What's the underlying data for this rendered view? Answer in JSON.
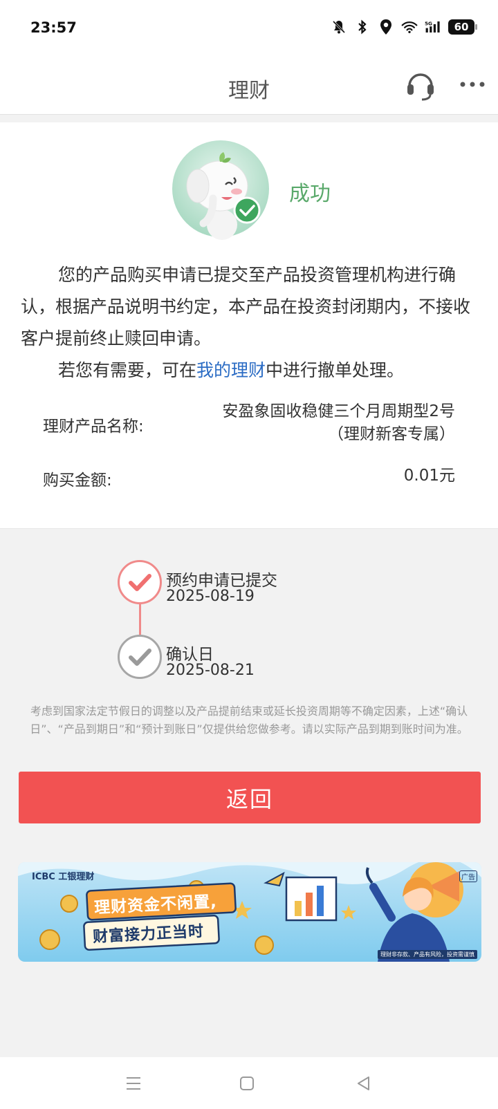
{
  "status_bar": {
    "time": "23:57",
    "icons": [
      "bell-off-icon",
      "bluetooth-icon",
      "location-icon",
      "wifi-icon",
      "signal-5g-icon"
    ],
    "battery": "60"
  },
  "nav": {
    "title": "理财",
    "support_icon": "headset-icon",
    "more_icon": "more-dots-icon"
  },
  "result": {
    "status": "成功",
    "message": "您的产品购买申请已提交至产品投资管理机构进行确认，根据产品说明书约定，本产品在投资封闭期内，不接收客户提前终止赎回申请。",
    "message2_prefix": "若您有需要，可在",
    "message2_link": "我的理财",
    "message2_suffix": "中进行撤单处理。"
  },
  "details": {
    "product_label": "理财产品名称:",
    "product_name_line1": "安盈象固收稳健三个月周期型2号",
    "product_name_line2": "（理财新客专属）",
    "amount_label": "购买金额:",
    "amount_value": "0.01元"
  },
  "timeline": [
    {
      "title": "预约申请已提交",
      "date": "2025-08-19",
      "state": "done"
    },
    {
      "title": "确认日",
      "date": "2025-08-21",
      "state": "pending"
    }
  ],
  "disclaimer_line1": "考虑到国家法定节假日的调整以及产品提前结束或延长投资周期等不确定因素，上述“确认",
  "disclaimer_line2": "日”、“产品到期日”和“预计到账日”仅提供给您做参考。请以实际产品到期到账时间为准。",
  "back_button": "返回",
  "banner": {
    "brand": "ICBC 工银理财",
    "ad_tag": "广告",
    "headline1": "理财资金不闲置,",
    "headline2": "财富接力正当时",
    "footnote": "理财非存款、产品有风险，投资需谨慎"
  },
  "colors": {
    "accent_red": "#f25252",
    "success_green": "#5aa96b",
    "link_blue": "#2b6cc4"
  }
}
